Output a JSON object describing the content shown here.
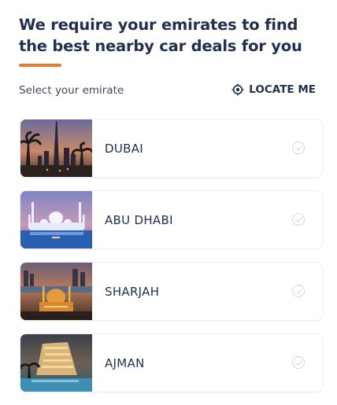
{
  "header": {
    "title": "We require your emirates to find the best nearby car deals for you",
    "accent_color": "#e87c2a"
  },
  "selector": {
    "label": "Select your emirate",
    "locate_label": "LOCATE ME",
    "locate_icon": "target-icon"
  },
  "emirates": [
    {
      "name": "DUBAI",
      "image": "dubai-skyline-image",
      "selected": false
    },
    {
      "name": "ABU DHABI",
      "image": "abu-dhabi-mosque-image",
      "selected": false
    },
    {
      "name": "SHARJAH",
      "image": "sharjah-mosque-image",
      "selected": false
    },
    {
      "name": "AJMAN",
      "image": "ajman-resort-image",
      "selected": false
    }
  ]
}
